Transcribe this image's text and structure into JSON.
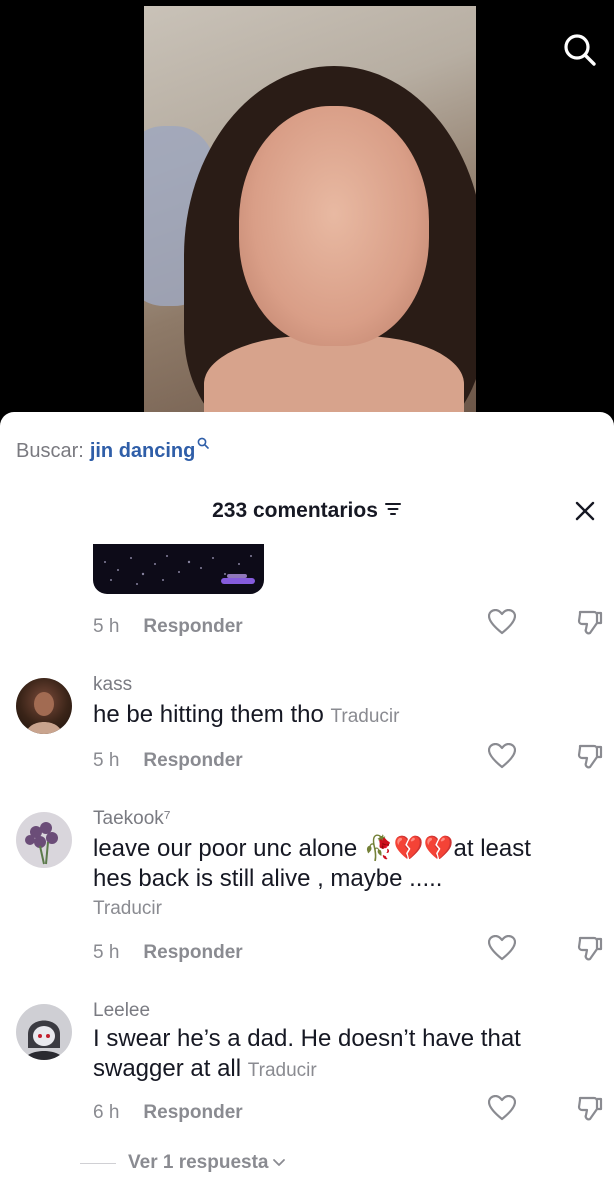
{
  "search": {
    "label": "Buscar:",
    "term": "jin dancing"
  },
  "header": {
    "count_label": "233 comentarios"
  },
  "comments": [
    {
      "time": "5 h",
      "reply_label": "Responder"
    },
    {
      "username": "kass",
      "text": "he be hitting them tho",
      "translate": "Traducir",
      "time": "5 h",
      "reply_label": "Responder"
    },
    {
      "username": "Taekook⁷",
      "text_line1": "leave our poor unc alone 🥀💔💔at least",
      "text_line2": "hes back is still alive , maybe .....",
      "translate": "Traducir",
      "time": "5 h",
      "reply_label": "Responder"
    },
    {
      "username": "Leelee",
      "text_line1": "I swear he’s a dad. He doesn’t have that",
      "text_line2": "swagger at all",
      "translate": "Traducir",
      "time": "6 h",
      "reply_label": "Responder"
    }
  ],
  "view_replies": "Ver 1 respuesta",
  "colors": {
    "link": "#2f5ea8",
    "muted": "#8a8b91",
    "text": "#161823"
  }
}
